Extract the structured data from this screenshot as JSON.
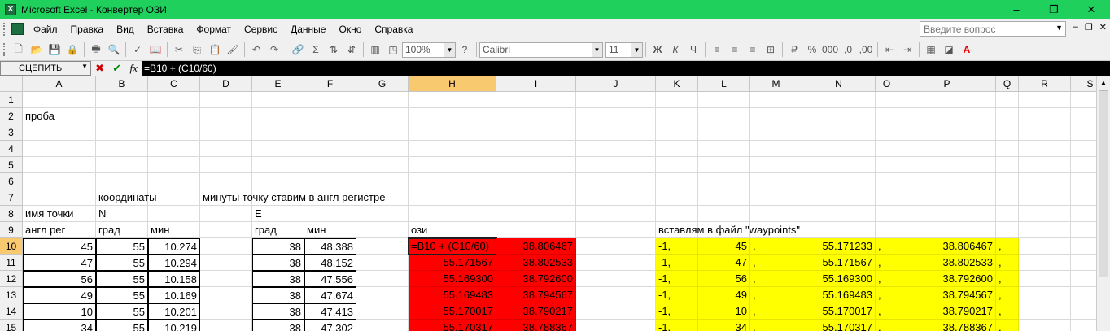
{
  "window": {
    "title": "Microsoft Excel - Конвертер ОЗИ",
    "app_icon": "excel-icon",
    "min": "–",
    "max": "❐",
    "close": "✕"
  },
  "menu": {
    "items": [
      "Файл",
      "Правка",
      "Вид",
      "Вставка",
      "Формат",
      "Сервис",
      "Данные",
      "Окно",
      "Справка"
    ],
    "ask_placeholder": "Введите вопрос",
    "doc_controls": [
      "–",
      "❐",
      "✕"
    ]
  },
  "toolbar": {
    "zoom": "100%",
    "font": "Calibri",
    "font_size": "11",
    "accent": "#1fd05c"
  },
  "formula_bar": {
    "name_box": "СЦЕПИТЬ",
    "cancel": "✖",
    "enter": "✔",
    "fx": "fx",
    "formula": "=B10 + (C10/60)"
  },
  "grid": {
    "columns": [
      "A",
      "B",
      "C",
      "D",
      "E",
      "F",
      "G",
      "H",
      "I",
      "J",
      "K",
      "L",
      "M",
      "N",
      "O",
      "P",
      "Q",
      "R",
      "S"
    ],
    "rows": [
      "1",
      "2",
      "3",
      "4",
      "5",
      "6",
      "7",
      "8",
      "9",
      "10",
      "11",
      "12",
      "13",
      "14",
      "15"
    ],
    "cells": {
      "A2": "проба",
      "B7": "координаты",
      "D7": "минуты точку ставим в англ регистре",
      "A8": "имя точки",
      "B8": "N",
      "E8": "E",
      "A9": "англ рег",
      "B9": "град",
      "C9": "мин",
      "E9": "град",
      "F9": "мин",
      "H9": "ози",
      "K9": "вставлям в файл \"waypoints\"",
      "A10": "45",
      "B10": "55",
      "C10": "10.274",
      "E10": "38",
      "F10": "48.388",
      "H10": "=B10 + (C10/60)",
      "I10": "38.806467",
      "K10": "-1,",
      "L10": "45",
      "M10": ",",
      "N10": "55.171233",
      "O10": ",",
      "P10": "38.806467",
      "Q10": ",",
      "A11": "47",
      "B11": "55",
      "C11": "10.294",
      "E11": "38",
      "F11": "48.152",
      "H11": "55.171567",
      "I11": "38.802533",
      "K11": "-1,",
      "L11": "47",
      "M11": ",",
      "N11": "55.171567",
      "O11": ",",
      "P11": "38.802533",
      "Q11": ",",
      "A12": "56",
      "B12": "55",
      "C12": "10.158",
      "E12": "38",
      "F12": "47.556",
      "H12": "55.169300",
      "I12": "38.792600",
      "K12": "-1,",
      "L12": "56",
      "M12": ",",
      "N12": "55.169300",
      "O12": ",",
      "P12": "38.792600",
      "Q12": ",",
      "A13": "49",
      "B13": "55",
      "C13": "10.169",
      "E13": "38",
      "F13": "47.674",
      "H13": "55.169483",
      "I13": "38.794567",
      "K13": "-1,",
      "L13": "49",
      "M13": ",",
      "N13": "55.169483",
      "O13": ",",
      "P13": "38.794567",
      "Q13": ",",
      "A14": "10",
      "B14": "55",
      "C14": "10.201",
      "E14": "38",
      "F14": "47.413",
      "H14": "55.170017",
      "I14": "38.790217",
      "K14": "-1,",
      "L14": "10",
      "M14": ",",
      "N14": "55.170017",
      "O14": ",",
      "P14": "38.790217",
      "Q14": ",",
      "A15": "34",
      "B15": "55",
      "C15": "10.219",
      "E15": "38",
      "F15": "47.302",
      "H15": "55.170317",
      "I15": "38.788367",
      "K15": "-1,",
      "L15": "34",
      "M15": ",",
      "N15": "55.170317",
      "O15": ",",
      "P15": "38.788367",
      "Q15": ","
    },
    "colors": {
      "red": "#ff0000",
      "yellow": "#ffff00",
      "header_selected": "#f9c970"
    }
  }
}
